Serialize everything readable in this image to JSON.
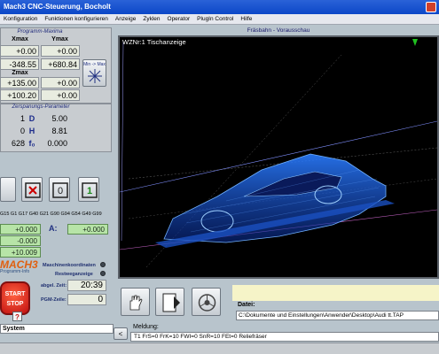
{
  "window": {
    "title": "Mach3 CNC-Steuerung, Bocholt"
  },
  "menu": [
    "Konfiguration",
    "Funktionen konfigurieren",
    "Anzeige",
    "Zyklen",
    "Operator",
    "PlugIn Control",
    "Hilfe"
  ],
  "programm_maxima": {
    "header": "Programm-Maxima",
    "xmax_label": "Xmax",
    "xmax": "+0.00",
    "ymax_label": "Ymax",
    "ymax": "+0.00",
    "xmin": "-348.55",
    "ymin": "+680.84",
    "zmax_label": "Zmax",
    "zmax": "+135.00",
    "zmax2": "+0.00",
    "zmin": "+100.20",
    "zmin2": "+0.00",
    "minmax_button": "Min -> Max"
  },
  "zerspanung": {
    "header": "Zerspanungs-Parameter",
    "rows": [
      {
        "v1": "1",
        "k": "D",
        "v2": "5.00"
      },
      {
        "v1": "0",
        "k": "H",
        "v2": "8.81"
      },
      {
        "v1": "628",
        "k": "f₀",
        "v2": "0.000"
      }
    ]
  },
  "gcodes": "G15 G1 G17 G40 G21 G90 G94 G54 G49 G99",
  "dro": {
    "x": "+0.000",
    "y": "-0.000",
    "z": "+10.009",
    "a_label": "A:",
    "a": "+0.000"
  },
  "logo": {
    "text": "MACH3",
    "sub": "Programm-Info"
  },
  "maschinenkoordinaten": "Maschinenkoordinaten",
  "restwegeanzeige": "Restweganzeige",
  "abgel_zeit_label": "abgel. Zeit:",
  "abgel_zeit": "20:39",
  "pgm_zeile_label": "PGM-Zeile:",
  "pgm_zeile": "0",
  "start_stop": {
    "line1": "START",
    "line2": "STOP"
  },
  "help_label": "?",
  "system_label": "System",
  "preview": {
    "title": "Fräsbahn - Vorausschau",
    "wzn": "WZNr:1  Tischanzeige"
  },
  "datei": {
    "label": "Datei:",
    "value": "C:\\Dokumente und Einstellungen\\Anwender\\Desktop\\Audi  tt.TAP"
  },
  "meldung": {
    "label": "Meldung:",
    "value": "T1 FrS=0 FrK=10 FWI=0 SnR=10 FEt=0   Reliefräser"
  },
  "nav_left": "<"
}
